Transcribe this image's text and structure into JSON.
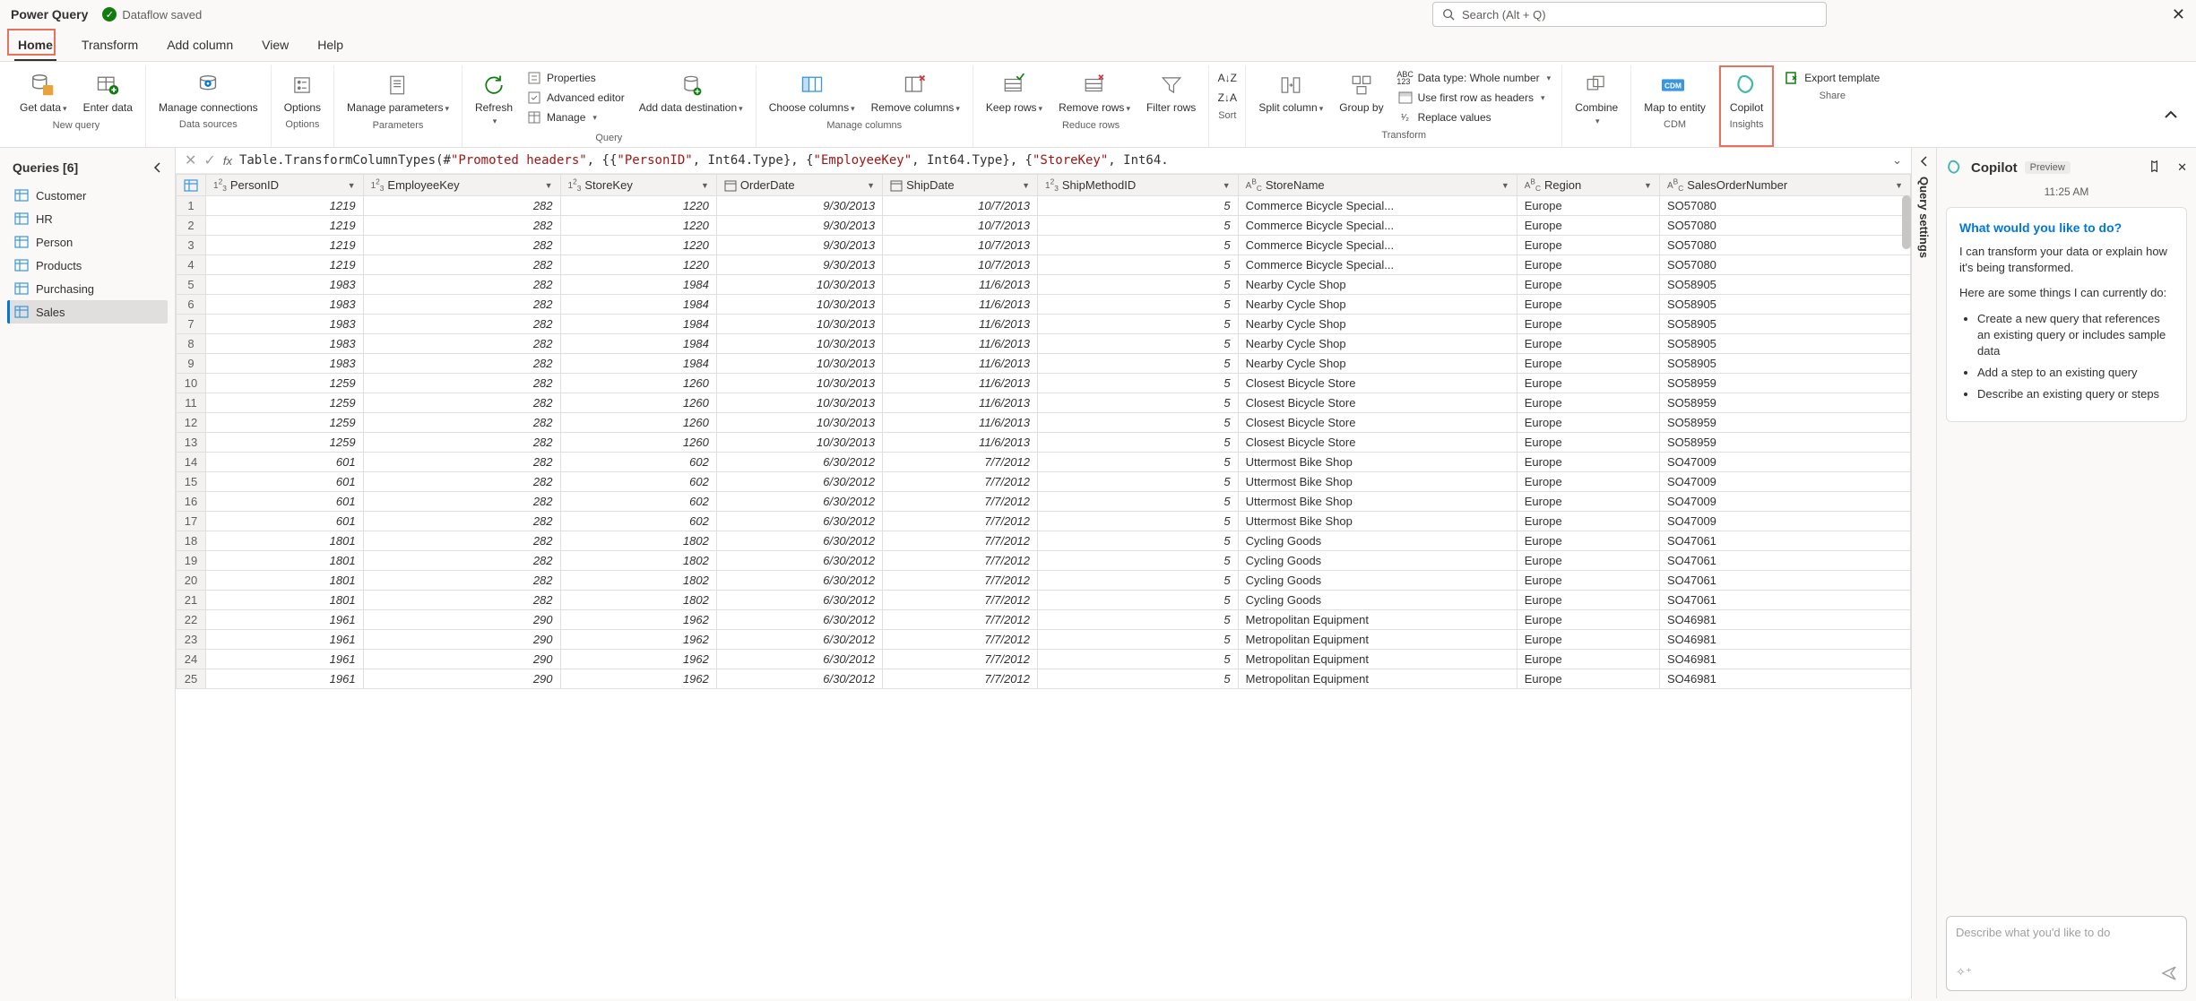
{
  "app": {
    "name": "Power Query",
    "status": "Dataflow saved",
    "search_placeholder": "Search (Alt + Q)"
  },
  "tabs": [
    "Home",
    "Transform",
    "Add column",
    "View",
    "Help"
  ],
  "ribbon": {
    "new_query": {
      "get_data": "Get data",
      "enter_data": "Enter data",
      "group": "New query"
    },
    "data_sources": {
      "manage_connections": "Manage connections",
      "group": "Data sources"
    },
    "options": {
      "options": "Options",
      "group": "Options"
    },
    "parameters": {
      "manage_parameters": "Manage parameters",
      "group": "Parameters"
    },
    "query": {
      "refresh": "Refresh",
      "properties": "Properties",
      "advanced_editor": "Advanced editor",
      "manage": "Manage",
      "add_data_destination": "Add data destination",
      "group": "Query"
    },
    "manage_columns": {
      "choose_columns": "Choose columns",
      "remove_columns": "Remove columns",
      "group": "Manage columns"
    },
    "reduce_rows": {
      "keep_rows": "Keep rows",
      "remove_rows": "Remove rows",
      "filter_rows": "Filter rows",
      "group": "Reduce rows"
    },
    "sort": {
      "group": "Sort"
    },
    "transform": {
      "split_column": "Split column",
      "group_by": "Group by",
      "data_type": "Data type: Whole number",
      "first_row_headers": "Use first row as headers",
      "replace_values": "Replace values",
      "group": "Transform"
    },
    "combine": {
      "label": "Combine"
    },
    "cdm": {
      "map_to_entity": "Map to entity",
      "group": "CDM"
    },
    "insights": {
      "copilot": "Copilot",
      "group": "Insights"
    },
    "share": {
      "export_template": "Export template",
      "group": "Share"
    }
  },
  "queries": {
    "title": "Queries [6]",
    "items": [
      "Customer",
      "HR",
      "Person",
      "Products",
      "Purchasing",
      "Sales"
    ],
    "active": "Sales"
  },
  "formula": {
    "prefix": "Table.TransformColumnTypes(#",
    "p1": "\"Promoted headers\"",
    "mid1": ", {{",
    "p2": "\"PersonID\"",
    "mid2": ", Int64.Type}, {",
    "p3": "\"EmployeeKey\"",
    "mid3": ", Int64.Type}, {",
    "p4": "\"StoreKey\"",
    "mid4": ", Int64."
  },
  "columns": [
    {
      "name": "PersonID",
      "type": "123"
    },
    {
      "name": "EmployeeKey",
      "type": "123"
    },
    {
      "name": "StoreKey",
      "type": "123"
    },
    {
      "name": "OrderDate",
      "type": "date"
    },
    {
      "name": "ShipDate",
      "type": "date"
    },
    {
      "name": "ShipMethodID",
      "type": "123"
    },
    {
      "name": "StoreName",
      "type": "abc"
    },
    {
      "name": "Region",
      "type": "abc"
    },
    {
      "name": "SalesOrderNumber",
      "type": "abc"
    }
  ],
  "rows": [
    [
      1,
      "1219",
      "282",
      "1220",
      "9/30/2013",
      "10/7/2013",
      "5",
      "Commerce Bicycle Special...",
      "Europe",
      "SO57080"
    ],
    [
      2,
      "1219",
      "282",
      "1220",
      "9/30/2013",
      "10/7/2013",
      "5",
      "Commerce Bicycle Special...",
      "Europe",
      "SO57080"
    ],
    [
      3,
      "1219",
      "282",
      "1220",
      "9/30/2013",
      "10/7/2013",
      "5",
      "Commerce Bicycle Special...",
      "Europe",
      "SO57080"
    ],
    [
      4,
      "1219",
      "282",
      "1220",
      "9/30/2013",
      "10/7/2013",
      "5",
      "Commerce Bicycle Special...",
      "Europe",
      "SO57080"
    ],
    [
      5,
      "1983",
      "282",
      "1984",
      "10/30/2013",
      "11/6/2013",
      "5",
      "Nearby Cycle Shop",
      "Europe",
      "SO58905"
    ],
    [
      6,
      "1983",
      "282",
      "1984",
      "10/30/2013",
      "11/6/2013",
      "5",
      "Nearby Cycle Shop",
      "Europe",
      "SO58905"
    ],
    [
      7,
      "1983",
      "282",
      "1984",
      "10/30/2013",
      "11/6/2013",
      "5",
      "Nearby Cycle Shop",
      "Europe",
      "SO58905"
    ],
    [
      8,
      "1983",
      "282",
      "1984",
      "10/30/2013",
      "11/6/2013",
      "5",
      "Nearby Cycle Shop",
      "Europe",
      "SO58905"
    ],
    [
      9,
      "1983",
      "282",
      "1984",
      "10/30/2013",
      "11/6/2013",
      "5",
      "Nearby Cycle Shop",
      "Europe",
      "SO58905"
    ],
    [
      10,
      "1259",
      "282",
      "1260",
      "10/30/2013",
      "11/6/2013",
      "5",
      "Closest Bicycle Store",
      "Europe",
      "SO58959"
    ],
    [
      11,
      "1259",
      "282",
      "1260",
      "10/30/2013",
      "11/6/2013",
      "5",
      "Closest Bicycle Store",
      "Europe",
      "SO58959"
    ],
    [
      12,
      "1259",
      "282",
      "1260",
      "10/30/2013",
      "11/6/2013",
      "5",
      "Closest Bicycle Store",
      "Europe",
      "SO58959"
    ],
    [
      13,
      "1259",
      "282",
      "1260",
      "10/30/2013",
      "11/6/2013",
      "5",
      "Closest Bicycle Store",
      "Europe",
      "SO58959"
    ],
    [
      14,
      "601",
      "282",
      "602",
      "6/30/2012",
      "7/7/2012",
      "5",
      "Uttermost Bike Shop",
      "Europe",
      "SO47009"
    ],
    [
      15,
      "601",
      "282",
      "602",
      "6/30/2012",
      "7/7/2012",
      "5",
      "Uttermost Bike Shop",
      "Europe",
      "SO47009"
    ],
    [
      16,
      "601",
      "282",
      "602",
      "6/30/2012",
      "7/7/2012",
      "5",
      "Uttermost Bike Shop",
      "Europe",
      "SO47009"
    ],
    [
      17,
      "601",
      "282",
      "602",
      "6/30/2012",
      "7/7/2012",
      "5",
      "Uttermost Bike Shop",
      "Europe",
      "SO47009"
    ],
    [
      18,
      "1801",
      "282",
      "1802",
      "6/30/2012",
      "7/7/2012",
      "5",
      "Cycling Goods",
      "Europe",
      "SO47061"
    ],
    [
      19,
      "1801",
      "282",
      "1802",
      "6/30/2012",
      "7/7/2012",
      "5",
      "Cycling Goods",
      "Europe",
      "SO47061"
    ],
    [
      20,
      "1801",
      "282",
      "1802",
      "6/30/2012",
      "7/7/2012",
      "5",
      "Cycling Goods",
      "Europe",
      "SO47061"
    ],
    [
      21,
      "1801",
      "282",
      "1802",
      "6/30/2012",
      "7/7/2012",
      "5",
      "Cycling Goods",
      "Europe",
      "SO47061"
    ],
    [
      22,
      "1961",
      "290",
      "1962",
      "6/30/2012",
      "7/7/2012",
      "5",
      "Metropolitan Equipment",
      "Europe",
      "SO46981"
    ],
    [
      23,
      "1961",
      "290",
      "1962",
      "6/30/2012",
      "7/7/2012",
      "5",
      "Metropolitan Equipment",
      "Europe",
      "SO46981"
    ],
    [
      24,
      "1961",
      "290",
      "1962",
      "6/30/2012",
      "7/7/2012",
      "5",
      "Metropolitan Equipment",
      "Europe",
      "SO46981"
    ],
    [
      25,
      "1961",
      "290",
      "1962",
      "6/30/2012",
      "7/7/2012",
      "5",
      "Metropolitan Equipment",
      "Europe",
      "SO46981"
    ]
  ],
  "qsettings_label": "Query settings",
  "copilot": {
    "title": "Copilot",
    "preview": "Preview",
    "timestamp": "11:25 AM",
    "headline": "What would you like to do?",
    "p1": "I can transform your data or explain how it's being transformed.",
    "p2": "Here are some things I can currently do:",
    "bullets": [
      "Create a new query that references an existing query or includes sample data",
      "Add a step to an existing query",
      "Describe an existing query or steps"
    ],
    "input_placeholder": "Describe what you'd like to do"
  }
}
